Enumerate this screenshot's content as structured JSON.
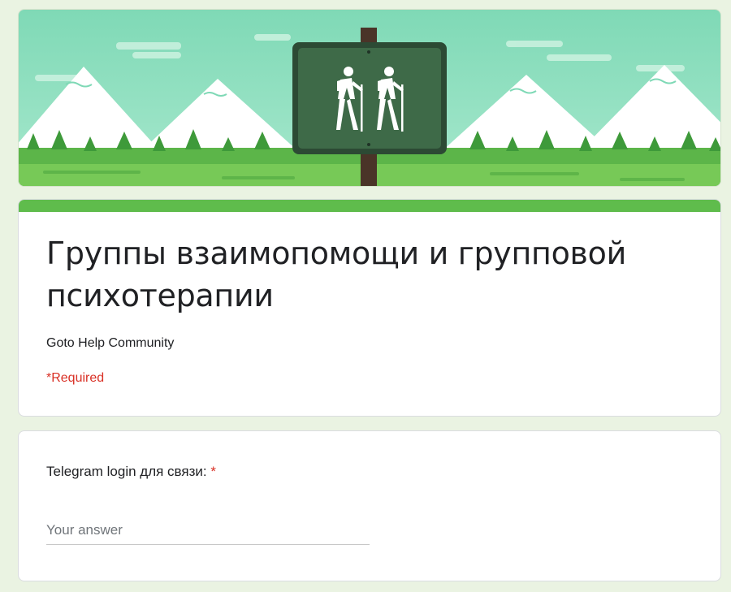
{
  "banner": {
    "image": "hiking-trail-sign-banner",
    "sign_icon": "two-hikers-icon"
  },
  "form": {
    "title": "Группы взаимопомощи и групповой психотерапии",
    "description": "Goto Help Community",
    "required_note": "*Required"
  },
  "questions": [
    {
      "label": "Telegram login для связи:",
      "required_mark": "*",
      "placeholder": "Your answer",
      "value": ""
    }
  ],
  "colors": {
    "accent": "#5fbc4c",
    "background": "#eaf3e2",
    "required": "#d93025"
  }
}
